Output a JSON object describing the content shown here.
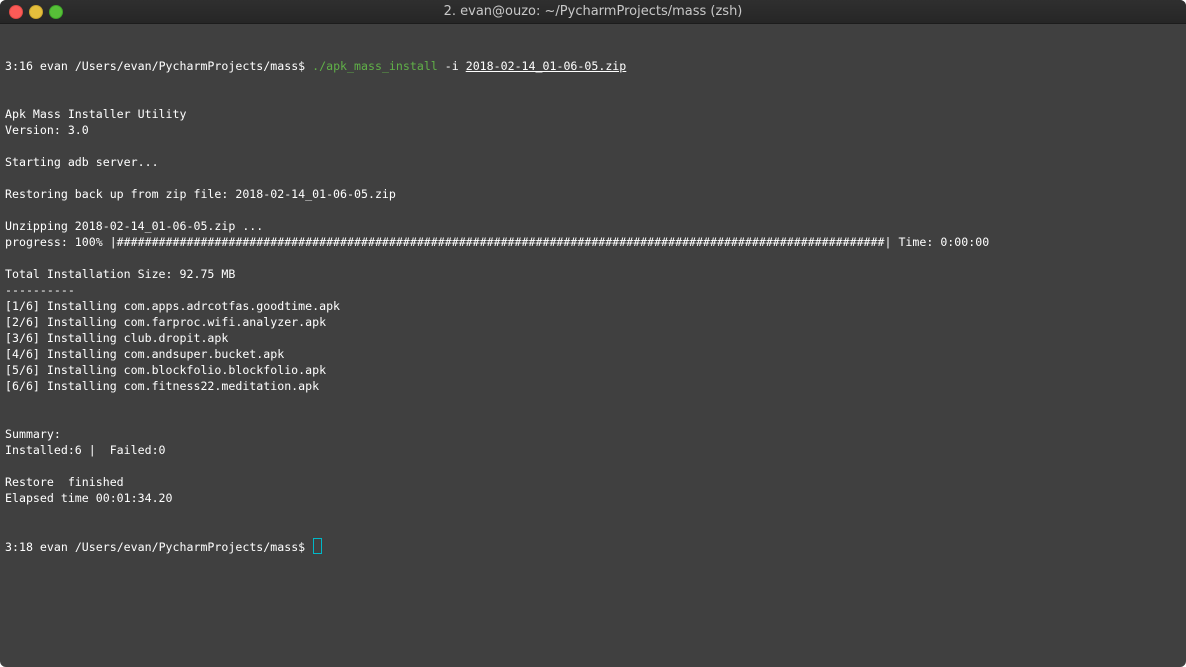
{
  "window": {
    "title": "2. evan@ouzo: ~/PycharmProjects/mass (zsh)"
  },
  "terminal": {
    "prompt1": {
      "time": "3:16",
      "user": "evan",
      "cwd": "/Users/evan/PycharmProjects/mass$",
      "command": "./apk_mass_install",
      "flag": "-i",
      "arg": "2018-02-14_01-06-05.zip"
    },
    "lines": [
      "Apk Mass Installer Utility",
      "Version: 3.0",
      "",
      "Starting adb server...",
      "",
      "Restoring back up from zip file: 2018-02-14_01-06-05.zip",
      "",
      "Unzipping 2018-02-14_01-06-05.zip ...",
      "progress: 100% |##############################################################################################################| Time: 0:00:00",
      "",
      "Total Installation Size: 92.75 MB",
      "----------",
      "[1/6] Installing com.apps.adrcotfas.goodtime.apk",
      "[2/6] Installing com.farproc.wifi.analyzer.apk",
      "[3/6] Installing club.dropit.apk",
      "[4/6] Installing com.andsuper.bucket.apk",
      "[5/6] Installing com.blockfolio.blockfolio.apk",
      "[6/6] Installing com.fitness22.meditation.apk",
      "",
      "",
      "Summary:",
      "Installed:6 |  Failed:0",
      "",
      "Restore  finished",
      "Elapsed time 00:01:34.20"
    ],
    "prompt2": {
      "time": "3:18",
      "user": "evan",
      "cwd": "/Users/evan/PycharmProjects/mass$"
    }
  },
  "colors": {
    "background": "#404040",
    "command": "#60b048",
    "cursor": "#00b8c8"
  }
}
